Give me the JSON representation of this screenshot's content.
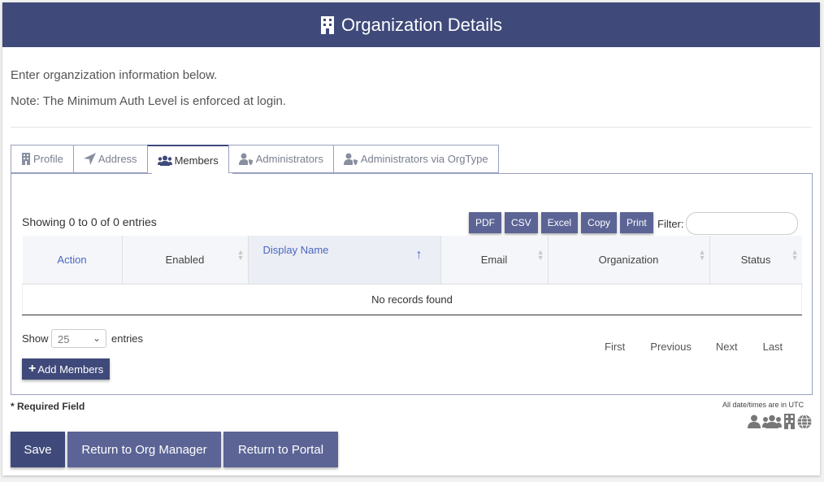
{
  "header": {
    "title": "Organization Details",
    "icon": "building-icon"
  },
  "intro": {
    "line1": "Enter organzization information below.",
    "line2": "Note: The Minimum Auth Level is enforced at login."
  },
  "tabs": [
    {
      "label": "Profile",
      "icon": "building-icon"
    },
    {
      "label": "Address",
      "icon": "location-arrow-icon"
    },
    {
      "label": "Members",
      "icon": "users-icon",
      "active": true
    },
    {
      "label": "Administrators",
      "icon": "user-shield-icon"
    },
    {
      "label": "Administrators via OrgType",
      "icon": "user-shield-icon"
    }
  ],
  "table": {
    "showing": "Showing 0 to 0 of 0 entries",
    "export_buttons": [
      "PDF",
      "CSV",
      "Excel",
      "Copy",
      "Print"
    ],
    "filter_label": "Filter:",
    "filter_value": "",
    "columns": [
      "Action",
      "Enabled",
      "Display Name",
      "Email",
      "Organization",
      "Status"
    ],
    "sorted_column": "Display Name",
    "empty_message": "No records found",
    "show_label": "Show",
    "page_size": "25",
    "entries_label": "entries",
    "pager": [
      "First",
      "Previous",
      "Next",
      "Last"
    ],
    "add_button": "Add Members"
  },
  "footer": {
    "required": "* Required Field",
    "utc_note": "All date/times are in UTC",
    "icons": [
      "user-icon",
      "users-icon",
      "building-icon",
      "globe-icon"
    ],
    "save": "Save",
    "return_org": "Return to Org Manager",
    "return_portal": "Return to Portal"
  },
  "colors": {
    "header": "#3f4a7a",
    "button": "#5b6495",
    "link": "#4a66c0"
  }
}
